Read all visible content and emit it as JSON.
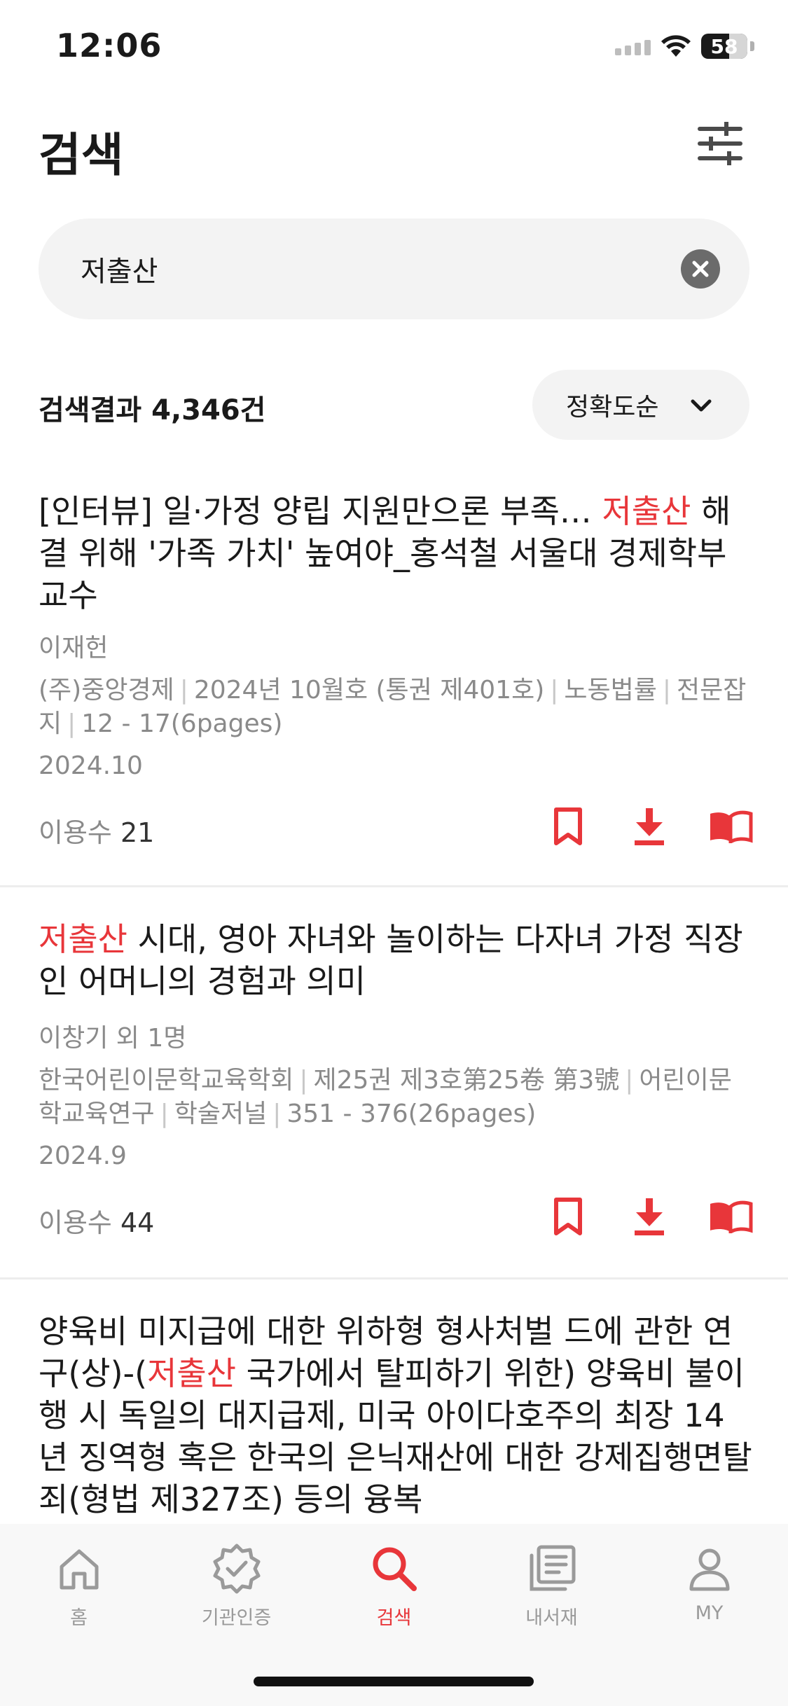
{
  "status": {
    "time": "12:06",
    "battery": "58"
  },
  "header": {
    "title": "검색"
  },
  "search": {
    "query": "저출산"
  },
  "results_bar": {
    "count_label": "검색결과 4,346건",
    "sort_label": "정확도순"
  },
  "results": [
    {
      "title_pre": "[인터뷰] 일·가정 양립 지원만으론 부족… ",
      "title_hl": "저출산",
      "title_post": " 해결 위해 '가족 가치' 높여야_홍석철 서울대 경제학부 교수",
      "author": "이재헌",
      "publisher": "(주)중앙경제",
      "issue": "2024년 10월호 (통권 제401호)",
      "journal": "노동법률",
      "type": "전문잡지",
      "pages": "12 - 17(6pages)",
      "date": "2024.10",
      "usage_label": "이용수",
      "usage_count": "21"
    },
    {
      "title_pre": "",
      "title_hl": "저출산",
      "title_post": " 시대, 영아 자녀와 놀이하는 다자녀 가정 직장인 어머니의 경험과 의미",
      "author": "이창기 외 1명",
      "publisher": "한국어린이문학교육학회",
      "issue": "제25권 제3호第25卷 第3號",
      "journal": "어린이문학교육연구",
      "type": "학술저널",
      "pages": "351 - 376(26pages)",
      "date": "2024.9",
      "usage_label": "이용수",
      "usage_count": "44"
    },
    {
      "title_pre": "양육비 미지급에 대한 위하형 형사처벌 드에 관한 연구(상)-(",
      "title_hl": "저출산",
      "title_post": " 국가에서 탈피하기 위한) 양육비 불이행 시 독일의 대지급제, 미국 아이다호주의 최장 14년 징역형 혹은 한국의 은닉재산에 대한 강제집행면탈죄(형법 제327조) 등의 융복"
    }
  ],
  "tabs": [
    {
      "label": "홈",
      "icon": "home-icon"
    },
    {
      "label": "기관인증",
      "icon": "verified-badge-icon"
    },
    {
      "label": "검색",
      "icon": "search-icon",
      "active": true
    },
    {
      "label": "내서재",
      "icon": "library-icon"
    },
    {
      "label": "MY",
      "icon": "person-icon"
    }
  ],
  "colors": {
    "accent": "#e8363a",
    "text": "#1a1a1a",
    "muted": "#8a8a8a",
    "surface": "#f3f3f3"
  }
}
